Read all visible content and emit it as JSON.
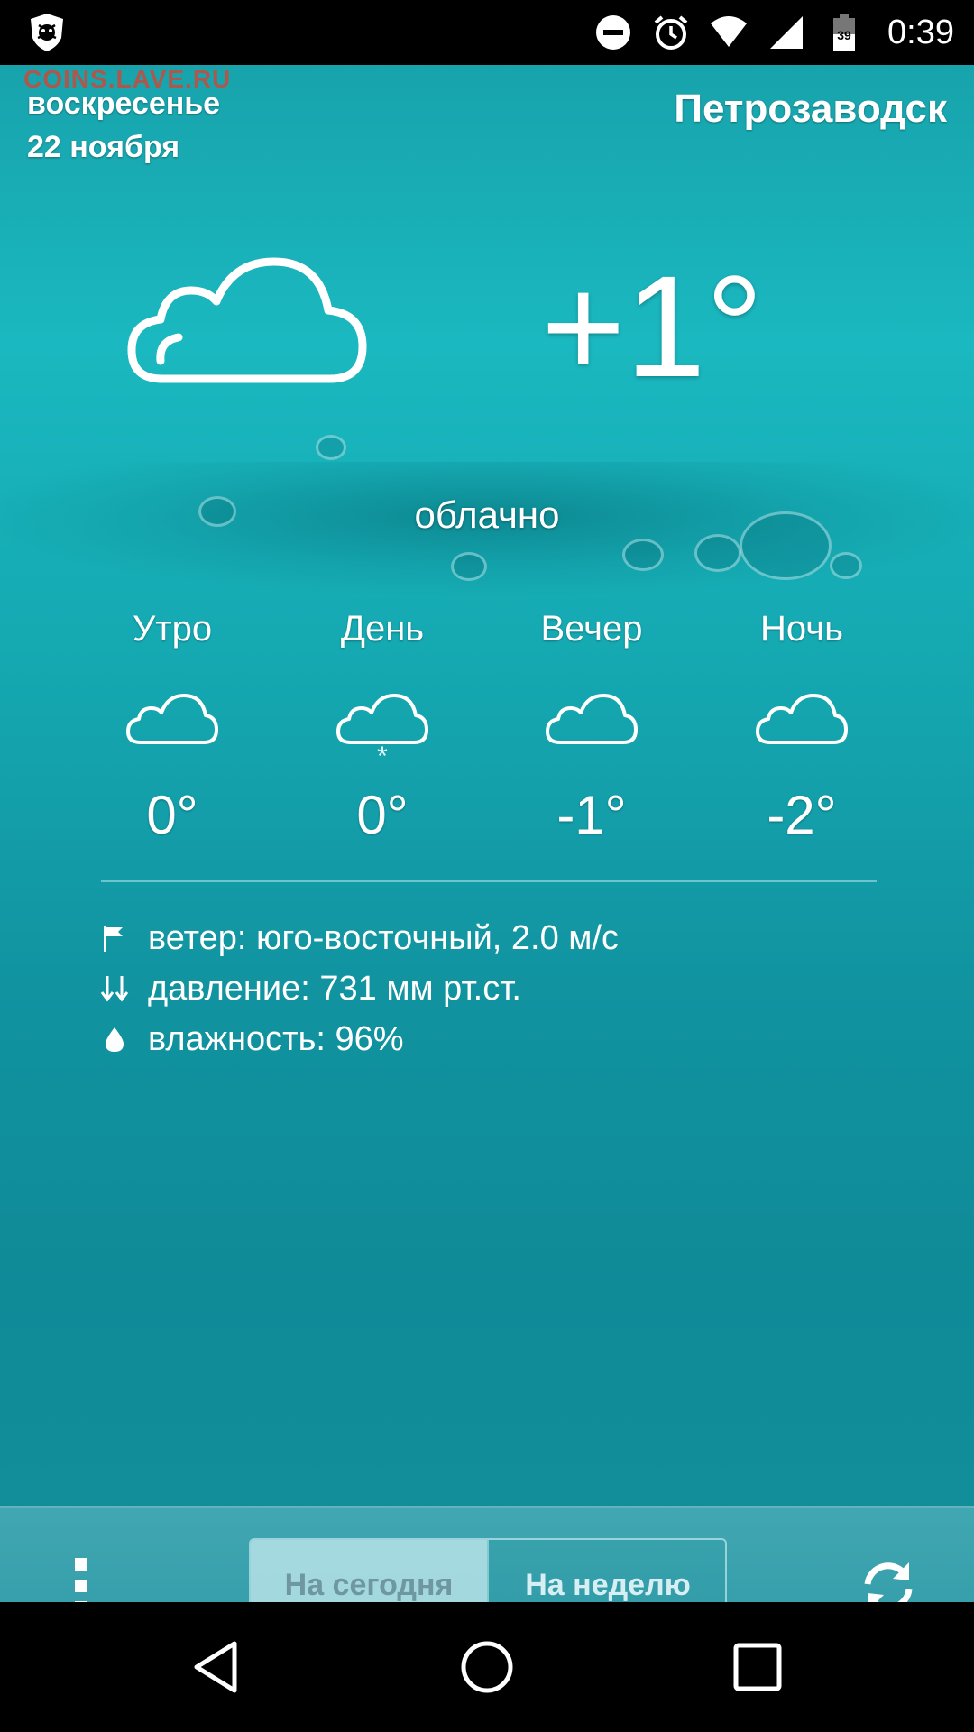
{
  "status_bar": {
    "time": "0:39",
    "battery_level": "39",
    "icons": [
      "app-shield-icon",
      "do-not-disturb-icon",
      "alarm-icon",
      "wifi-icon",
      "cell-signal-icon",
      "battery-icon"
    ]
  },
  "header": {
    "watermark": "COINS.LAVE.RU",
    "weekday": "воскресенье",
    "date": "22 ноября",
    "city": "Петрозаводск"
  },
  "current": {
    "icon": "cloud-icon",
    "temperature": "+1°",
    "condition": "облачно"
  },
  "periods": [
    {
      "name": "Утро",
      "icon": "cloud-icon",
      "temp": "0°",
      "snow": ""
    },
    {
      "name": "День",
      "icon": "cloud-snow-icon",
      "temp": "0°",
      "snow": "*"
    },
    {
      "name": "Вечер",
      "icon": "cloud-icon",
      "temp": "-1°",
      "snow": ""
    },
    {
      "name": "Ночь",
      "icon": "cloud-icon",
      "temp": "-2°",
      "snow": ""
    }
  ],
  "details": {
    "wind": "ветер: юго-восточный, 2.0 м/с",
    "pressure": "давление: 731 мм рт.ст.",
    "humidity": "влажность: 96%"
  },
  "toolbar": {
    "today_label": "На сегодня",
    "week_label": "На неделю",
    "active_tab": "На сегодня"
  },
  "colors": {
    "background": "#15a9b2",
    "toolbar": "#3aa2ad",
    "text": "#ffffff"
  }
}
